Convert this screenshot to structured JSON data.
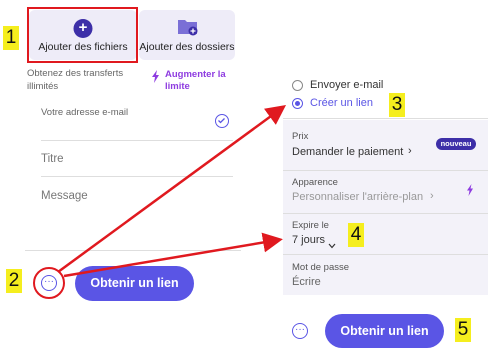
{
  "annotations": {
    "n1": "1",
    "n2": "2",
    "n3": "3",
    "n4": "4",
    "n5": "5"
  },
  "left": {
    "add_files": "Ajouter des fichiers",
    "add_folders": "Ajouter des dossiers",
    "unlimited_1": "Obtenez des transferts",
    "unlimited_2": "illimités",
    "upgrade_1": "Augmenter la",
    "upgrade_2": "limite",
    "email_placeholder": "Votre adresse e-mail",
    "title_placeholder": "Titre",
    "message_placeholder": "Message",
    "get_link": "Obtenir un lien"
  },
  "right": {
    "send_email": "Envoyer e-mail",
    "create_link": "Créer un lien",
    "price_label": "Prix",
    "price_value": "Demander le paiement",
    "new_badge": "nouveau",
    "appearance_label": "Apparence",
    "appearance_value": "Personnaliser l'arrière-plan",
    "expires_label": "Expire le",
    "expires_value": "7 jours",
    "password_label": "Mot de passe",
    "password_value": "Écrire",
    "get_link": "Obtenir un lien"
  },
  "colors": {
    "accent": "#5a55e5",
    "brand": "#3d2fa8",
    "upgrade": "#8e3ce0",
    "highlight": "#e0191f",
    "label_bg": "#f5ee1e"
  }
}
